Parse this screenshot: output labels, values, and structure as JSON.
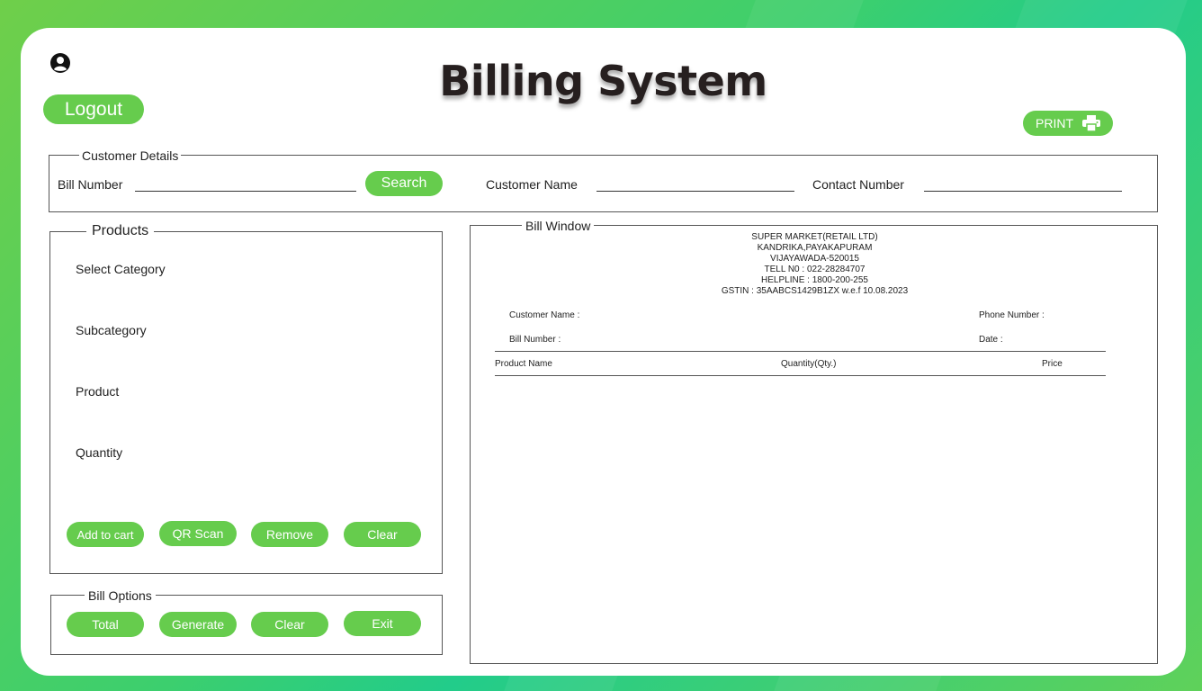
{
  "header": {
    "title": "Billing System",
    "logout_label": "Logout",
    "print_label": "PRINT"
  },
  "customer_details": {
    "legend": "Customer Details",
    "bill_number_label": "Bill Number",
    "bill_number_value": "",
    "search_label": "Search",
    "customer_name_label": "Customer Name",
    "customer_name_value": "",
    "contact_number_label": "Contact Number",
    "contact_number_value": ""
  },
  "products": {
    "legend": "Products",
    "select_category_label": "Select Category",
    "subcategory_label": "Subcategory",
    "product_label": "Product",
    "quantity_label": "Quantity",
    "add_to_cart_label": "Add to cart",
    "qr_scan_label": "QR Scan",
    "remove_label": "Remove",
    "clear_label": "Clear"
  },
  "bill_options": {
    "legend": "Bill Options",
    "total_label": "Total",
    "generate_label": "Generate",
    "clear_label": "Clear",
    "exit_label": "Exit"
  },
  "bill_window": {
    "legend": "Bill Window",
    "store_lines": [
      "SUPER MARKET(RETAIL LTD)",
      "KANDRIKA,PAYAKAPURAM",
      "VIJAYAWADA-520015",
      "TELL N0 : 022-28284707",
      "HELPLINE : 1800-200-255",
      "GSTIN : 35AABCS1429B1ZX w.e.f 10.08.2023"
    ],
    "customer_name_label": "Customer Name :",
    "phone_number_label": "Phone Number :",
    "bill_number_label": "Bill Number :",
    "date_label": "Date :",
    "columns": [
      "Product Name",
      "Quantity(Qty.)",
      "Price"
    ]
  },
  "colors": {
    "accent": "#66cc4d",
    "title": "#261f1f",
    "card": "#ffffff"
  }
}
